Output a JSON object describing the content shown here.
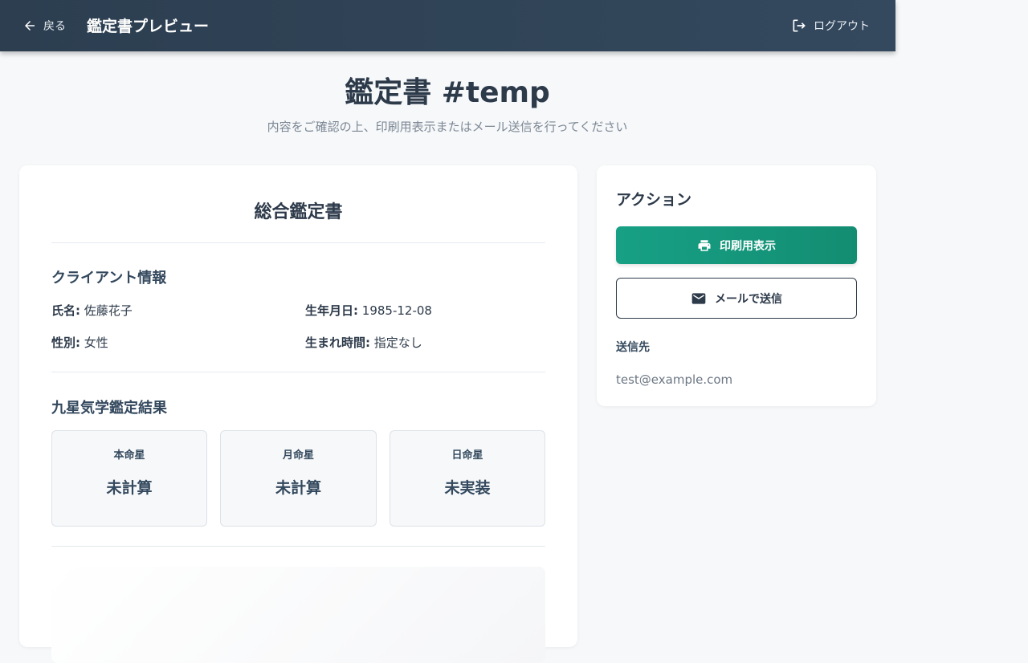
{
  "header": {
    "back_label": "戻る",
    "title": "鑑定書プレビュー",
    "logout_label": "ログアウト"
  },
  "page": {
    "title": "鑑定書 #temp",
    "subtitle": "内容をご確認の上、印刷用表示またはメール送信を行ってください"
  },
  "report": {
    "title": "総合鑑定書",
    "client_section_title": "クライアント情報",
    "client": {
      "name_label": "氏名:",
      "name_value": "佐藤花子",
      "birthdate_label": "生年月日:",
      "birthdate_value": "1985-12-08",
      "gender_label": "性別:",
      "gender_value": "女性",
      "birthtime_label": "生まれ時間:",
      "birthtime_value": "指定なし"
    },
    "kyusei_section_title": "九星気学鑑定結果",
    "stars": [
      {
        "label": "本命星",
        "value": "未計算"
      },
      {
        "label": "月命星",
        "value": "未計算"
      },
      {
        "label": "日命星",
        "value": "未実装"
      }
    ]
  },
  "actions": {
    "title": "アクション",
    "print_label": "印刷用表示",
    "mail_label": "メールで送信",
    "destination_label": "送信先",
    "destination_value": "test@example.com"
  },
  "colors": {
    "header_bg": "#2c3e50",
    "accent_green": "#17a085",
    "page_bg": "#f6f8fa"
  },
  "icons": {
    "back": "arrow-left-icon",
    "logout": "logout-icon",
    "print": "printer-icon",
    "mail": "mail-icon"
  }
}
